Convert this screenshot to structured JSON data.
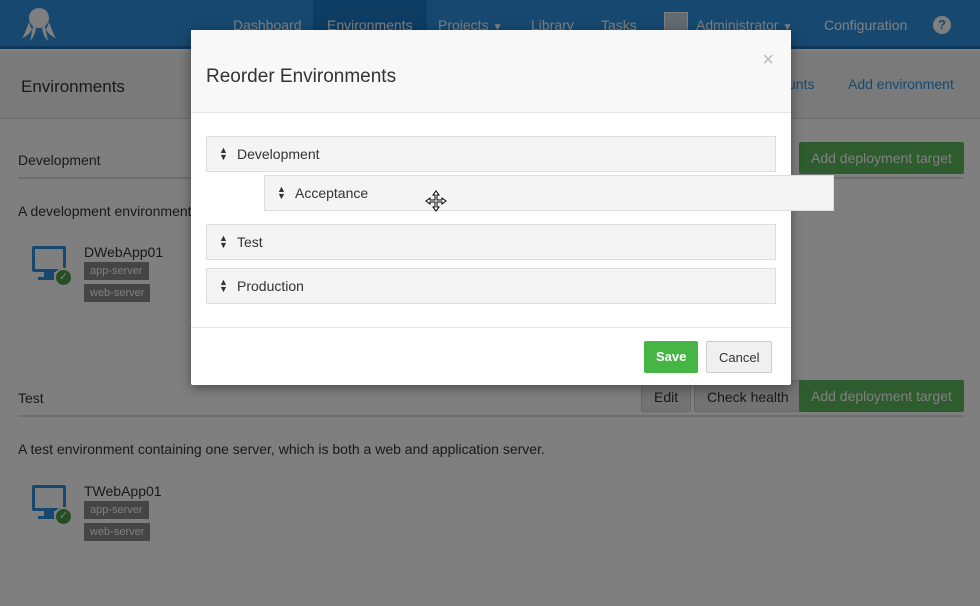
{
  "nav": {
    "items": [
      {
        "label": "Dashboard",
        "active": false
      },
      {
        "label": "Environments",
        "active": true
      },
      {
        "label": "Projects",
        "active": false
      },
      {
        "label": "Library",
        "active": false
      },
      {
        "label": "Tasks",
        "active": false
      }
    ],
    "user_label": "Administrator",
    "configuration_label": "Configuration",
    "help_label": "?"
  },
  "subheader": {
    "title": "Environments",
    "accounts_link": "unts",
    "add_environment_link": "Add environment"
  },
  "environments": [
    {
      "name": "Development",
      "description": "A development environment c",
      "add_target_label": "Add deployment target",
      "machine": {
        "name": "DWebApp01",
        "roles": [
          "app-server",
          "web-server"
        ]
      }
    },
    {
      "name": "Test",
      "description": "A test environment containing one server, which is both a web and application server.",
      "edit_label": "Edit",
      "health_label": "Check health",
      "add_target_label": "Add deployment target",
      "machine": {
        "name": "TWebApp01",
        "roles": [
          "app-server",
          "web-server"
        ]
      }
    }
  ],
  "modal": {
    "title": "Reorder Environments",
    "close_label": "×",
    "rows": [
      {
        "label": "Development"
      },
      {
        "label": "Test"
      },
      {
        "label": "Production"
      }
    ],
    "dragging_row": {
      "label": "Acceptance"
    },
    "save_label": "Save",
    "cancel_label": "Cancel"
  },
  "colors": {
    "brand": "#2f93e0",
    "success": "#5cb85c",
    "save": "#45b545"
  }
}
